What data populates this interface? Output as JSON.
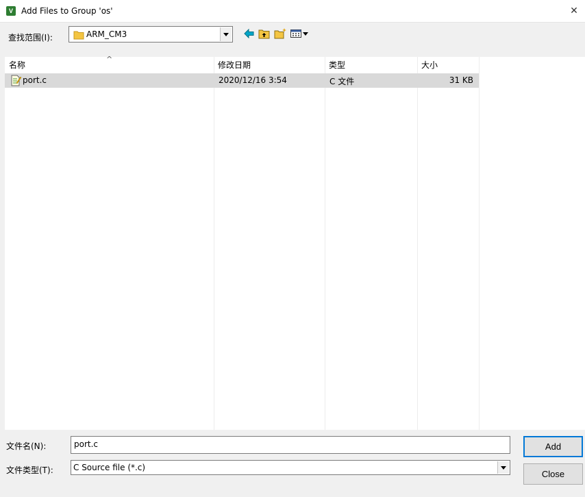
{
  "window": {
    "title": "Add Files to Group 'os'",
    "close_glyph": "✕",
    "app_icon_letter": "V"
  },
  "lookin": {
    "label": "查找范围(I):",
    "value": "ARM_CM3"
  },
  "toolbar": {
    "icons": [
      "back-arrow-icon",
      "up-folder-icon",
      "new-folder-icon",
      "view-menu-icon"
    ]
  },
  "list": {
    "columns": [
      "名称",
      "修改日期",
      "类型",
      "大小"
    ],
    "sort_indicator": "^",
    "rows": [
      {
        "name": "port.c",
        "modified": "2020/12/16 3:54",
        "type": "C 文件",
        "size": "31 KB"
      }
    ]
  },
  "filename": {
    "label": "文件名(N):",
    "value": "port.c"
  },
  "filetype": {
    "label": "文件类型(T):",
    "value": "C Source file (*.c)"
  },
  "buttons": {
    "add": "Add",
    "close": "Close"
  },
  "colors": {
    "selection": "#d9d9d9",
    "accent": "#0078d7",
    "folder": "#f4c542",
    "back_arrow": "#00a6c8"
  }
}
